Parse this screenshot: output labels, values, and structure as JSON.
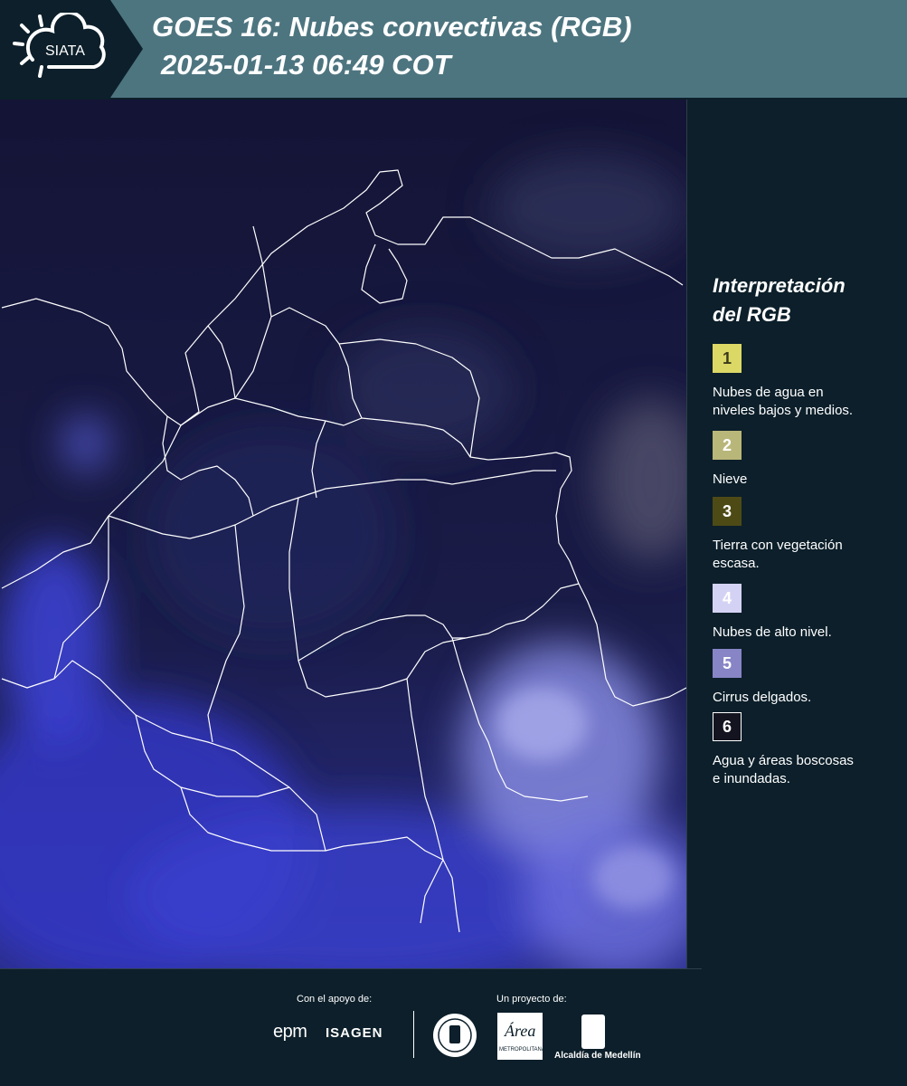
{
  "header": {
    "logo_text": "SIATA",
    "title_line1": "GOES 16: Nubes convectivas (RGB)",
    "title_line2": "2025-01-13 06:49 COT"
  },
  "map": {
    "type": "satellite RGB image",
    "region": "Colombia"
  },
  "legend": {
    "title_line1": "Interpretación",
    "title_line2": "del RGB",
    "items": [
      {
        "num": "1",
        "label_line1": "Nubes de agua en",
        "label_line2": "niveles bajos y medios.",
        "color": "#dcd866",
        "text_color": "#3a3a1a"
      },
      {
        "num": "2",
        "label_line1": "Nieve",
        "label_line2": "",
        "color": "#b9b67a",
        "text_color": "#ffffff"
      },
      {
        "num": "3",
        "label_line1": "Tierra con vegetación",
        "label_line2": "escasa.",
        "color": "#4e4a16",
        "text_color": "#ffffff"
      },
      {
        "num": "4",
        "label_line1": "Nubes de alto nivel.",
        "label_line2": "",
        "color": "#d4d2f4",
        "text_color": "#ffffff"
      },
      {
        "num": "5",
        "label_line1": "Cirrus delgados.",
        "label_line2": "",
        "color": "#8785c6",
        "text_color": "#ffffff"
      },
      {
        "num": "6",
        "label_line1": "Agua y áreas boscosas",
        "label_line2": "e inundadas.",
        "color": "#141420",
        "text_color": "#ffffff"
      }
    ]
  },
  "footer": {
    "support_label": "Con el apoyo de:",
    "project_label": "Un proyecto de:",
    "sponsor1": "epm",
    "sponsor2": "ISAGEN",
    "partner_area": "Área",
    "partner_area_caption": "METROPOLITANA",
    "partner_alcaldia": "Alcaldía de Medellín"
  }
}
